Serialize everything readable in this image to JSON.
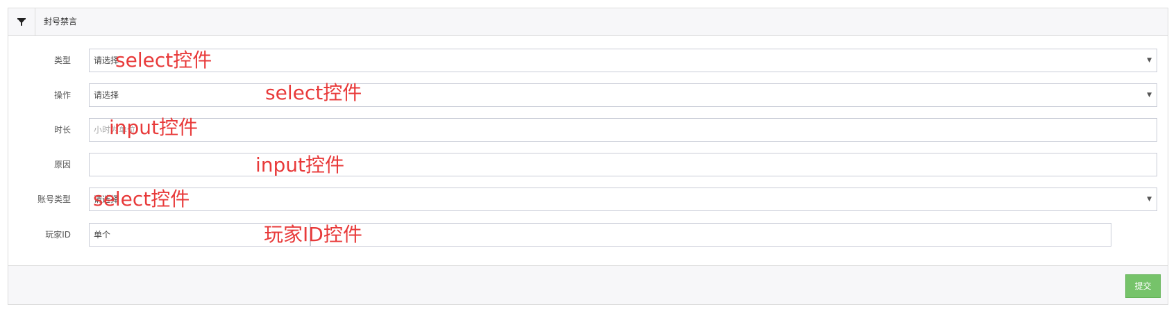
{
  "header": {
    "title": "封号禁言",
    "icon": "filter-icon"
  },
  "form": {
    "type": {
      "label": "类型",
      "value": "请选择"
    },
    "action": {
      "label": "操作",
      "value": "请选择"
    },
    "duration": {
      "label": "时长",
      "placeholder": "小时为单位"
    },
    "reason": {
      "label": "原因",
      "value": ""
    },
    "account_type": {
      "label": "账号类型",
      "value": "请选择"
    },
    "player_id": {
      "label": "玩家ID",
      "value": "单个"
    }
  },
  "caret": "▼",
  "annotations": {
    "type": "select控件",
    "action": "select控件",
    "duration": "input控件",
    "reason": "input控件",
    "account_type": "select控件",
    "player_id": "玩家ID控件"
  },
  "footer": {
    "submit_label": "提交"
  },
  "colors": {
    "annotation": "#e83a3a",
    "submit": "#76c36a",
    "header_bg": "#f7f7f9",
    "border": "#dcdcdc"
  }
}
